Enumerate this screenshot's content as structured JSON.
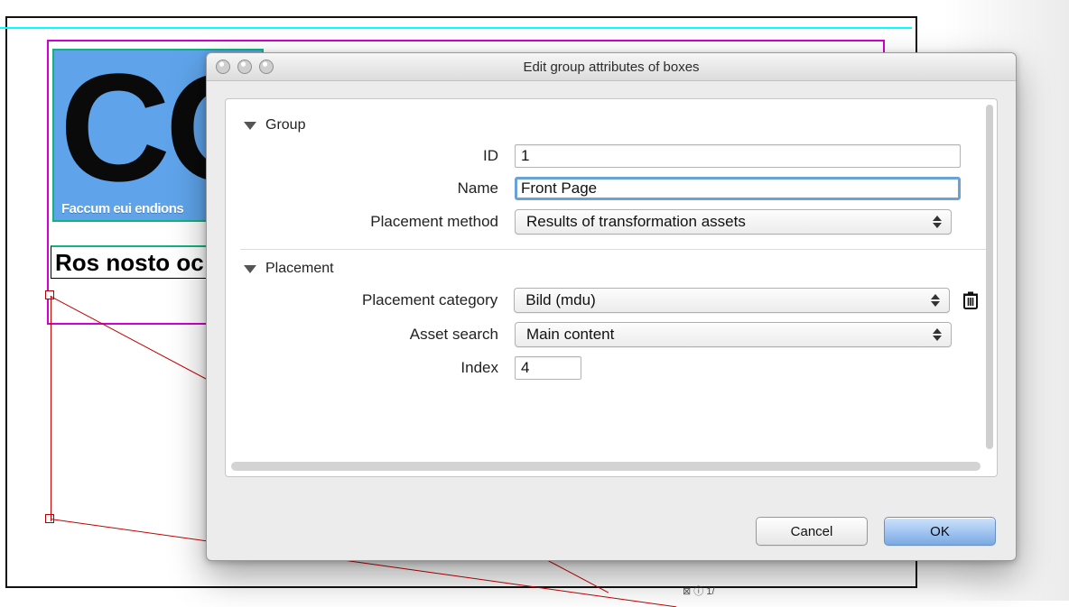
{
  "dialog": {
    "title": "Edit group attributes of boxes",
    "sections": {
      "group": {
        "header": "Group",
        "fields": {
          "id": {
            "label": "ID",
            "value": "1"
          },
          "name": {
            "label": "Name",
            "value": "Front Page"
          },
          "placement_method": {
            "label": "Placement method",
            "value": "Results of transformation assets"
          }
        }
      },
      "placement": {
        "header": "Placement",
        "fields": {
          "category": {
            "label": "Placement category",
            "value": "Bild (mdu)"
          },
          "asset_search": {
            "label": "Asset search",
            "value": "Main content"
          },
          "index": {
            "label": "Index",
            "value": "4"
          }
        }
      }
    },
    "buttons": {
      "cancel": "Cancel",
      "ok": "OK"
    }
  },
  "background": {
    "masthead_text": "CO",
    "masthead_caption": "Faccum eui endions",
    "headline": "Ros nosto oc",
    "status": "⊠ ⓘ 1/"
  }
}
